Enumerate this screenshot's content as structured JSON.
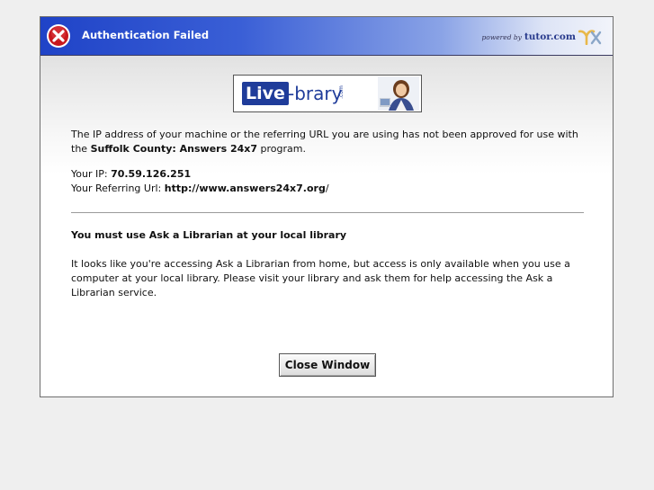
{
  "dialog": {
    "title": "Authentication Failed",
    "powered_by": "powered by",
    "brand": "tutor.com",
    "icons": {
      "error": "error-x-icon",
      "brand_mark": "tutor-brand-mark-icon"
    },
    "colors": {
      "titlebar_start": "#1f43c7",
      "titlebar_end": "#f2f4fa",
      "error_icon": "#c8181e",
      "logo_blue": "#1f3c9a"
    }
  },
  "logo": {
    "live": "Live",
    "brary": "-brary",
    "com": ".com"
  },
  "message": {
    "intro": "The IP address of your machine or the referring URL you are using has not been approved for use with the ",
    "program_name": "Suffolk County: Answers 24x7",
    "program_suffix": " program.",
    "ip_label": "Your IP: ",
    "ip_value": "70.59.126.251",
    "url_label": "Your Referring Url: ",
    "url_value": "http://www.answers24x7.org",
    "url_suffix": "/"
  },
  "notice": {
    "heading": "You must use Ask a Librarian at your local library",
    "body": "It looks like you're accessing Ask a Librarian from home, but access is only available when you use a computer at your local library. Please visit your library and ask them for help accessing the Ask a Librarian service."
  },
  "actions": {
    "close_label": "Close Window"
  }
}
